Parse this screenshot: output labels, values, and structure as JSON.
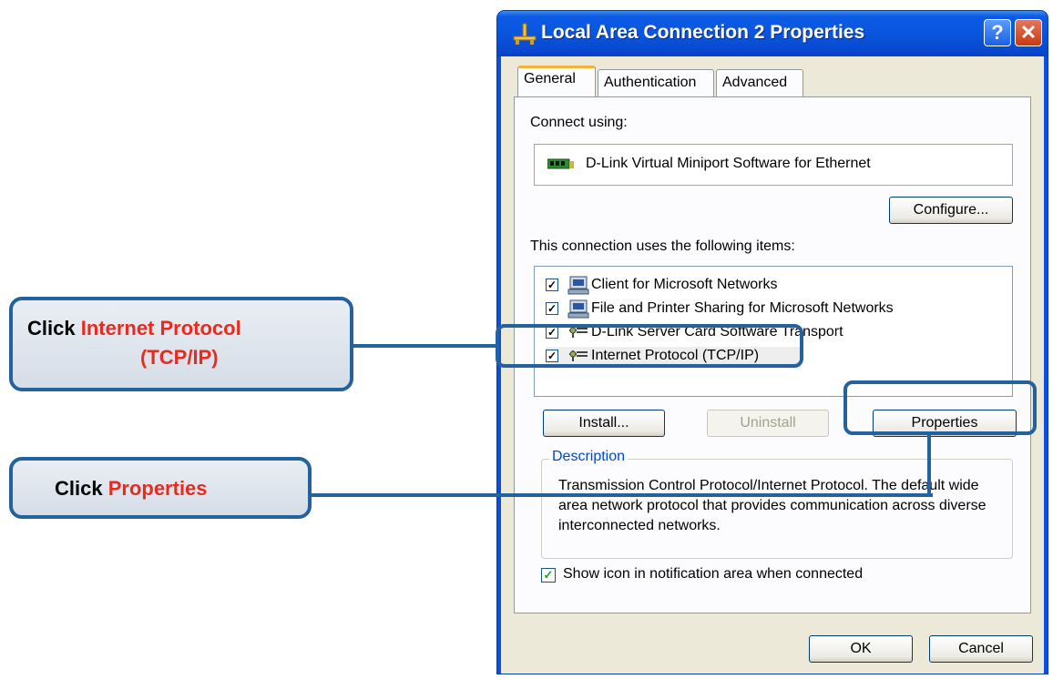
{
  "window": {
    "title": "Local Area Connection 2 Properties",
    "help_label": "?",
    "close_label": "✕"
  },
  "tabs": [
    {
      "label": "General",
      "active": true
    },
    {
      "label": "Authentication",
      "active": false
    },
    {
      "label": "Advanced",
      "active": false
    }
  ],
  "general": {
    "connect_using_label": "Connect using:",
    "adapter_name": "D-Link Virtual Miniport Software for Ethernet",
    "configure_button": "Configure...",
    "items_label": "This connection uses the following items:",
    "items": [
      {
        "label": "Client for Microsoft Networks",
        "checked": true,
        "icon": "network-client-icon"
      },
      {
        "label": "File and Printer Sharing for Microsoft Networks",
        "checked": true,
        "icon": "file-printer-sharing-icon"
      },
      {
        "label": "D-Link Server Card Software Transport",
        "checked": true,
        "icon": "protocol-icon"
      },
      {
        "label": "Internet Protocol (TCP/IP)",
        "checked": true,
        "icon": "protocol-icon"
      }
    ],
    "install_button": "Install...",
    "uninstall_button": "Uninstall",
    "properties_button": "Properties",
    "description_legend": "Description",
    "description_text": "Transmission Control Protocol/Internet Protocol. The default wide area network protocol that provides communication across diverse interconnected networks.",
    "show_icon_label": "Show icon in notification area when connected",
    "show_icon_checked": true
  },
  "footer": {
    "ok_button": "OK",
    "cancel_button": "Cancel"
  },
  "callouts": {
    "tcpip": {
      "prefix": "Click ",
      "accent_line1": "Internet Protocol",
      "accent_line2": "(TCP/IP)"
    },
    "properties": {
      "prefix": "Click ",
      "accent": "Properties"
    }
  },
  "colors": {
    "callout_border": "#23629c",
    "callout_accent": "#e82a1f",
    "titlebar": "#0a55de"
  }
}
